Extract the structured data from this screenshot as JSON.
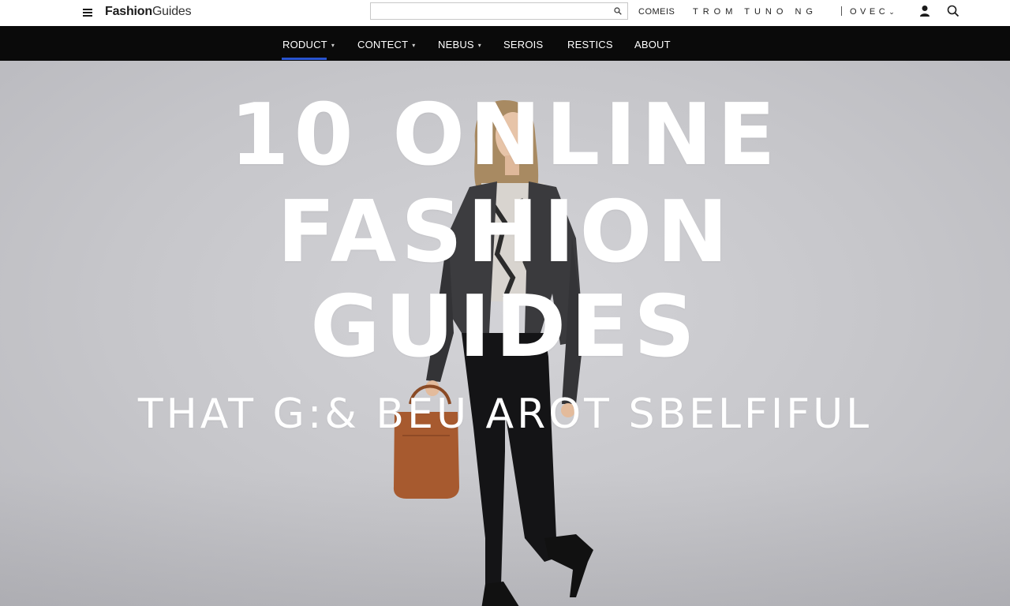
{
  "topbar": {
    "logo_bold": "Fashion",
    "logo_rest": "Guides",
    "search_placeholder": "",
    "links": [
      "COMEIS",
      "TROM TUNO NG",
      "OVEC"
    ]
  },
  "nav": {
    "items": [
      {
        "label": "RODUCT",
        "dropdown": true
      },
      {
        "label": "CONTECT",
        "dropdown": true
      },
      {
        "label": "NEBUS",
        "dropdown": true
      },
      {
        "label": "SEROIS",
        "dropdown": false
      },
      {
        "label": "RESTICS",
        "dropdown": false
      },
      {
        "label": "ABOUT",
        "dropdown": false
      }
    ],
    "active": "RODUCT"
  },
  "hero": {
    "line1": "10 ONLINE",
    "line2": "FASHION",
    "line3": "GUIDES",
    "subline": "THAT G:& BEU AROT SBELFIFUL"
  },
  "colors": {
    "navbar": "#0a0a0a",
    "active_indicator": "#2a55d0",
    "hero_bg": "#c9c9cd",
    "headline": "#ffffff"
  },
  "icons": [
    "menu-icon",
    "search-icon",
    "user-icon"
  ]
}
